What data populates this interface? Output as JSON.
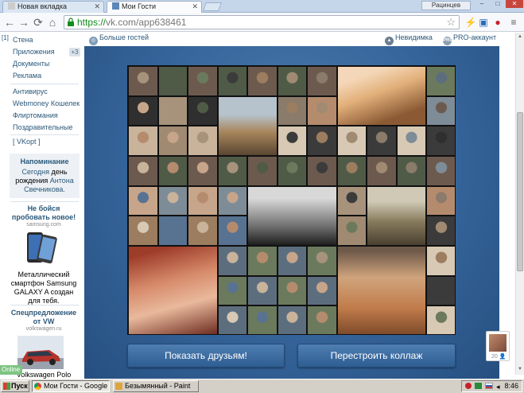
{
  "browser": {
    "tabs": [
      {
        "title": "Новая вкладка",
        "active": false
      },
      {
        "title": "Мои Гости",
        "active": true
      }
    ],
    "window_user": "Рацинцев",
    "url_protocol": "https://",
    "url_rest": "vk.com/app638461"
  },
  "sidebar": {
    "counter": "[1]",
    "links": [
      "Стена",
      "Приложения",
      "Документы",
      "Реклама",
      "Антивирус",
      "Webmoney Кошелек",
      "Флиртомания",
      "Поздравительные",
      "[ VKopt ]"
    ],
    "apps_badge": "+3",
    "reminder": {
      "title": "Напоминание",
      "today": "Сегодня",
      "text1": "день",
      "text2": "рождения",
      "person": "Антона Свечникова."
    },
    "ads": [
      {
        "title": "Не бойся пробовать новое!",
        "domain": "samsung.com",
        "text": "Металлический смартфон Samsung GALAXY A создан для тебя."
      },
      {
        "title": "Спецпредложение от VW",
        "domain": "volkswagen.ru",
        "text": "Volkswagen Polo"
      }
    ],
    "online": "Online"
  },
  "app_header": {
    "more_guests": "Больше гостей",
    "invisible": "Невидимка",
    "pro_badge": "PRO",
    "pro_account": "PRO-аккаунт"
  },
  "collage": {
    "tile_count": 78
  },
  "buttons": {
    "show_friends": "Показать друзьям!",
    "rebuild": "Перестроить коллаж"
  },
  "friend_widget": {
    "count": "20"
  },
  "taskbar": {
    "start": "Пуск",
    "tasks": [
      {
        "label": "Мои Гости - Google C...",
        "active": true
      },
      {
        "label": "Безымянный - Paint",
        "active": false
      }
    ],
    "clock": "8:46"
  },
  "colors": {
    "vk_link": "#2b587a",
    "app_bg": "#35649a",
    "button_bg": "#3d6da3"
  }
}
